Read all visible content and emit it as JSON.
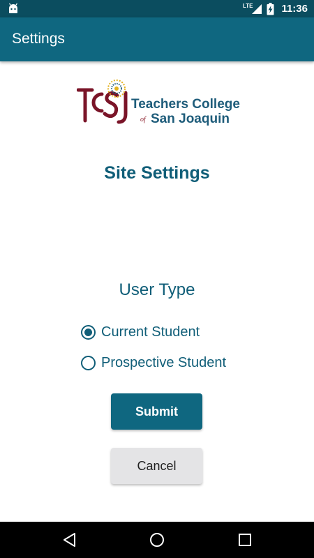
{
  "status_bar": {
    "network": "LTE",
    "time": "11:36",
    "icons": [
      "android-icon",
      "signal-icon",
      "battery-charging-icon"
    ]
  },
  "app_bar": {
    "title": "Settings"
  },
  "logo": {
    "monogram": "TCSJ",
    "line1": "Teachers College",
    "of": "of",
    "line2": "San Joaquin",
    "colors": {
      "monogram": "#7a1428",
      "text": "#1e5c7a",
      "sun": "#e3b21f",
      "ring": "#1e5c7a"
    }
  },
  "main": {
    "heading": "Site Settings",
    "user_type_label": "User Type",
    "options": [
      {
        "label": "Current Student",
        "selected": true
      },
      {
        "label": "Prospective Student",
        "selected": false
      }
    ],
    "submit_label": "Submit",
    "cancel_label": "Cancel"
  },
  "nav_bar": {
    "icons": [
      "back-icon",
      "home-icon",
      "recent-apps-icon"
    ]
  },
  "colors": {
    "status_bar": "#0b4d5f",
    "app_bar": "#0f6780",
    "accent": "#105e78",
    "cancel_bg": "#e4e4e6"
  }
}
